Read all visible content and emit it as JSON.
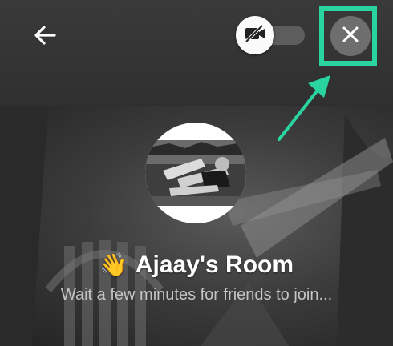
{
  "header": {
    "back_icon": "arrow-left-icon",
    "camera_toggle": {
      "icon": "video-off-icon",
      "state": "off"
    },
    "close_icon": "close-icon"
  },
  "annotation": {
    "highlight_color": "#2ad4a0",
    "arrow_color": "#2ad4a0"
  },
  "room": {
    "emoji": "👋",
    "title": "Ajaay's Room",
    "subtitle": "Wait a few minutes for friends to join..."
  },
  "colors": {
    "topbar": "#353535",
    "close_bg": "#6e6e6e",
    "toggle_track": "#5d5d5d"
  }
}
